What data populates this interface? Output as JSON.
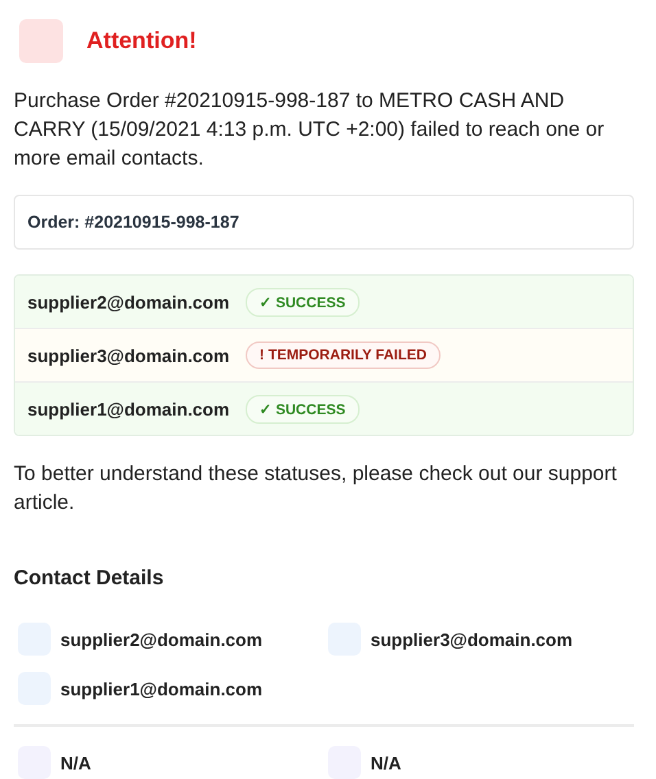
{
  "alert": {
    "title": "Attention!"
  },
  "message": "Purchase Order #20210915-998-187 to METRO CASH AND CARRY (15/09/2021 4:13 p.m. UTC +2:00) failed to reach one or more email contacts.",
  "order": {
    "label": "Order:",
    "value": "#20210915-998-187"
  },
  "deliveries": [
    {
      "email": "supplier2@domain.com",
      "kind": "success",
      "status": "✓ SUCCESS"
    },
    {
      "email": "supplier3@domain.com",
      "kind": "failed",
      "status": "! TEMPORARILY FAILED"
    },
    {
      "email": "supplier1@domain.com",
      "kind": "success",
      "status": "✓ SUCCESS"
    }
  ],
  "help_text": "To better understand these statuses, please check out our support article.",
  "contact_details": {
    "title": "Contact Details",
    "contacts": [
      "supplier2@domain.com",
      "supplier3@domain.com",
      "supplier1@domain.com"
    ],
    "other": [
      "N/A",
      "N/A"
    ]
  }
}
